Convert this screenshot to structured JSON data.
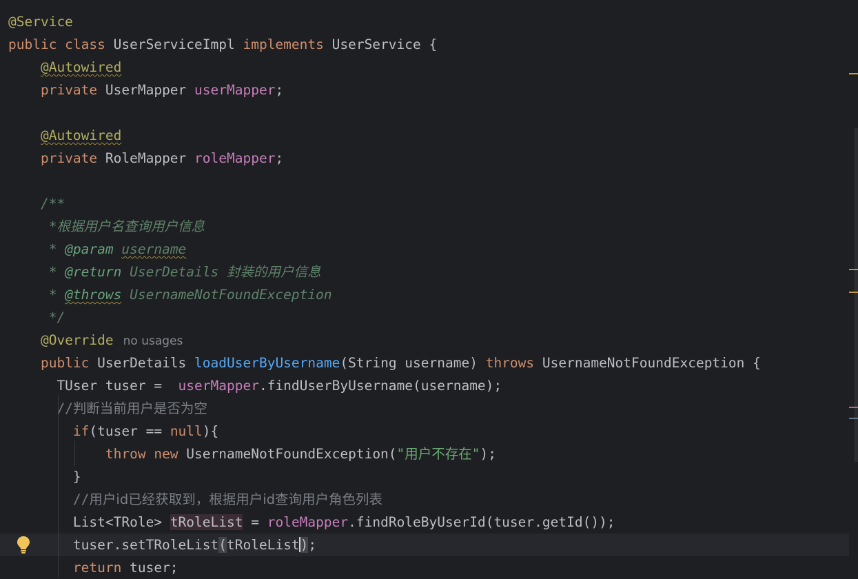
{
  "editor": {
    "lines": [
      {
        "tokens": [
          {
            "t": "@Service",
            "c": "ann"
          }
        ]
      },
      {
        "tokens": [
          {
            "t": "public class ",
            "c": "kw"
          },
          {
            "t": "UserServiceImpl "
          },
          {
            "t": "implements ",
            "c": "kw"
          },
          {
            "t": "UserService {"
          }
        ]
      },
      {
        "tokens": [
          {
            "t": "    "
          },
          {
            "t": "@Autowired",
            "c": "ann wavy"
          }
        ]
      },
      {
        "tokens": [
          {
            "t": "    "
          },
          {
            "t": "private ",
            "c": "kw"
          },
          {
            "t": "UserMapper "
          },
          {
            "t": "userMapper",
            "c": "field"
          },
          {
            "t": ";"
          }
        ]
      },
      {
        "tokens": []
      },
      {
        "tokens": [
          {
            "t": "    "
          },
          {
            "t": "@Autowired",
            "c": "ann wavy"
          }
        ]
      },
      {
        "tokens": [
          {
            "t": "    "
          },
          {
            "t": "private ",
            "c": "kw"
          },
          {
            "t": "RoleMapper "
          },
          {
            "t": "roleMapper",
            "c": "field"
          },
          {
            "t": ";"
          }
        ]
      },
      {
        "tokens": []
      },
      {
        "tokens": [
          {
            "t": "    "
          },
          {
            "t": "/**",
            "c": "doc"
          }
        ]
      },
      {
        "tokens": [
          {
            "t": "     *",
            "c": "doc"
          },
          {
            "t": "根据用户名查询用户信息",
            "c": "doc docsans"
          }
        ]
      },
      {
        "tokens": [
          {
            "t": "     * ",
            "c": "doc"
          },
          {
            "t": "@param ",
            "c": "doctag"
          },
          {
            "t": "username",
            "c": "doc wavy"
          }
        ]
      },
      {
        "tokens": [
          {
            "t": "     * ",
            "c": "doc"
          },
          {
            "t": "@return ",
            "c": "doctag"
          },
          {
            "t": "UserDetails ",
            "c": "doc"
          },
          {
            "t": "封装的用户信息",
            "c": "doc docsans"
          }
        ]
      },
      {
        "tokens": [
          {
            "t": "     * ",
            "c": "doc"
          },
          {
            "t": "@throws",
            "c": "doctag wavy"
          },
          {
            "t": " UsernameNotFoundException",
            "c": "doc"
          }
        ]
      },
      {
        "tokens": [
          {
            "t": "     */",
            "c": "doc"
          }
        ]
      },
      {
        "tokens": [
          {
            "t": "    "
          },
          {
            "t": "@Override",
            "c": "ann"
          }
        ],
        "hint": "no usages"
      },
      {
        "tokens": [
          {
            "t": "    "
          },
          {
            "t": "public ",
            "c": "kw"
          },
          {
            "t": "UserDetails "
          },
          {
            "t": "loadUserByUsername",
            "c": "method"
          },
          {
            "t": "(String username) "
          },
          {
            "t": "throws ",
            "c": "kw"
          },
          {
            "t": "UsernameNotFoundException {"
          }
        ]
      },
      {
        "tokens": [
          {
            "t": "      TUser tuser =  "
          },
          {
            "t": "userMapper",
            "c": "field"
          },
          {
            "t": ".findUserByUsername(username);"
          }
        ]
      },
      {
        "tokens": [
          {
            "t": "      //",
            "c": "cmt"
          },
          {
            "t": "判断当前用户是否为空",
            "c": "cmt sans"
          }
        ]
      },
      {
        "tokens": [
          {
            "t": "        "
          },
          {
            "t": "if",
            "c": "kw"
          },
          {
            "t": "(tuser == "
          },
          {
            "t": "null",
            "c": "kw"
          },
          {
            "t": "){"
          }
        ]
      },
      {
        "tokens": [
          {
            "t": "            "
          },
          {
            "t": "throw new ",
            "c": "kw"
          },
          {
            "t": "UsernameNotFoundException("
          },
          {
            "t": "\"用户不存在\"",
            "c": "str"
          },
          {
            "t": ");"
          }
        ]
      },
      {
        "tokens": [
          {
            "t": "        }"
          }
        ]
      },
      {
        "tokens": [
          {
            "t": "        //",
            "c": "cmt"
          },
          {
            "t": "用户id已经获取到，根据用户id查询用户角色列表",
            "c": "cmt sans"
          }
        ]
      },
      {
        "tokens": [
          {
            "t": "        List<TRole> "
          },
          {
            "t": "tRoleList",
            "c": "hl"
          },
          {
            "t": " = "
          },
          {
            "t": "roleMapper",
            "c": "field"
          },
          {
            "t": ".findRoleByUserId(tuser.getId());"
          }
        ]
      },
      {
        "tokens": [
          {
            "t": "        tuser.setTRoleList"
          },
          {
            "t": "(",
            "c": "bracket"
          },
          {
            "t": "tRoleList"
          },
          {
            "t": "",
            "c": "caret"
          },
          {
            "t": ")",
            "c": "bracket"
          },
          {
            "t": ";"
          }
        ],
        "current": true
      },
      {
        "tokens": [
          {
            "t": "        "
          },
          {
            "t": "return ",
            "c": "kw"
          },
          {
            "t": "tuser;"
          }
        ]
      }
    ]
  },
  "gutter": {
    "intention_icon": "lightbulb-icon"
  },
  "colors": {
    "background": "#1e1f22",
    "keyword": "#cf8e6d",
    "annotation": "#b3ae60",
    "field": "#c77dbb",
    "method": "#56a8f5",
    "string": "#6aab73",
    "doc_comment": "#5f826b"
  }
}
